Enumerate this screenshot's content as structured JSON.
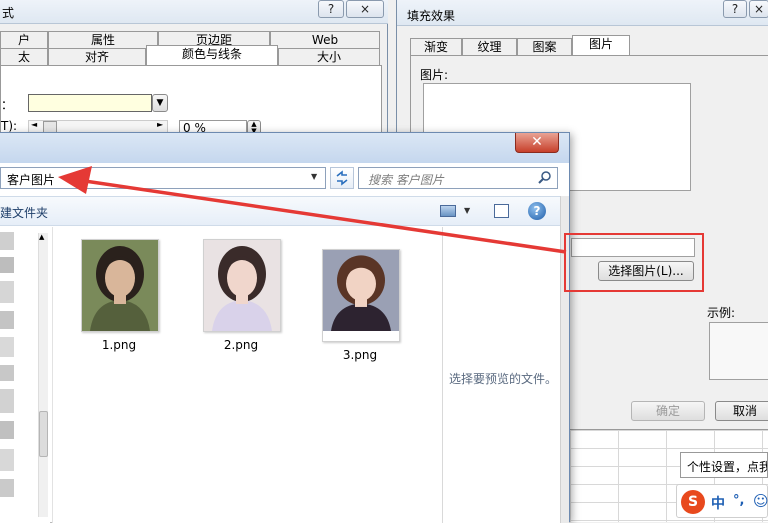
{
  "format_dialog": {
    "title_fragment": "式",
    "help_glyph": "?",
    "close_glyph": "×",
    "tabs_row1": [
      "户",
      "属性",
      "页边距",
      "Web"
    ],
    "tabs_row2": [
      "太",
      "对齐",
      "颜色与线条",
      "大小"
    ],
    "color_label_fragment": "：",
    "transparency_label_fragment": "T):",
    "transparency_value": "0 %",
    "fill_color": "#ffffe0"
  },
  "fill_dialog": {
    "title": "填充效果",
    "help_glyph": "?",
    "close_glyph": "×",
    "tabs": [
      "渐变",
      "纹理",
      "图案",
      "图片"
    ],
    "picture_label": "图片:",
    "select_picture_button": "选择图片(L)...",
    "sample_label": "示例:",
    "ok_button": "确定",
    "cancel_button": "取消"
  },
  "file_dialog": {
    "close_glyph": "✕",
    "address_path": "客户图片",
    "search_placeholder": "搜索 客户图片",
    "new_folder_label": "建文件夹",
    "help_glyph": "?",
    "files": [
      {
        "name": "1.png",
        "bg": "#7a8a5a",
        "skin": "#d9b69a",
        "hair": "#2a211c",
        "cloth": "#55603c"
      },
      {
        "name": "2.png",
        "bg": "#e9e2e3",
        "skin": "#f0d6cc",
        "hair": "#3a2b2a",
        "cloth": "#d9d2ea"
      },
      {
        "name": "3.png",
        "bg": "#9aa0b4",
        "skin": "#f1d3c4",
        "hair": "#5a3526",
        "cloth": "#2d2330"
      }
    ],
    "preview_message": "选择要预览的文件。"
  },
  "taskbar": {
    "tooltip_text": "个性设置，点我",
    "ime_logo": "S",
    "ime_mode": "中",
    "ime_punct": "°,",
    "ime_face": "☺"
  },
  "annotation_color": "#e53935"
}
